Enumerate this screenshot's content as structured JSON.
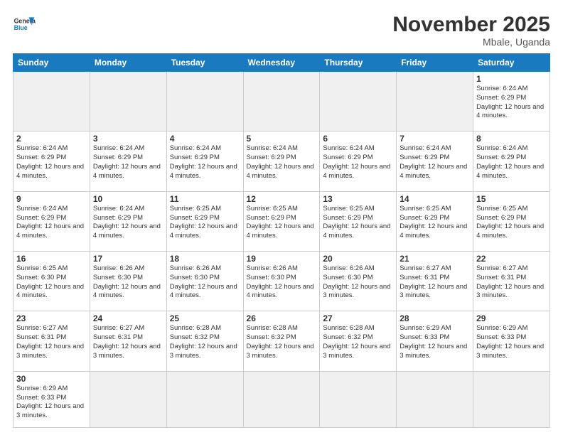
{
  "header": {
    "logo_general": "General",
    "logo_blue": "Blue",
    "month_title": "November 2025",
    "location": "Mbale, Uganda"
  },
  "days_of_week": [
    "Sunday",
    "Monday",
    "Tuesday",
    "Wednesday",
    "Thursday",
    "Friday",
    "Saturday"
  ],
  "weeks": [
    [
      {
        "day": "",
        "info": "",
        "empty": true
      },
      {
        "day": "",
        "info": "",
        "empty": true
      },
      {
        "day": "",
        "info": "",
        "empty": true
      },
      {
        "day": "",
        "info": "",
        "empty": true
      },
      {
        "day": "",
        "info": "",
        "empty": true
      },
      {
        "day": "",
        "info": "",
        "empty": true
      },
      {
        "day": "1",
        "info": "Sunrise: 6:24 AM\nSunset: 6:29 PM\nDaylight: 12 hours\nand 4 minutes."
      }
    ],
    [
      {
        "day": "2",
        "info": "Sunrise: 6:24 AM\nSunset: 6:29 PM\nDaylight: 12 hours\nand 4 minutes."
      },
      {
        "day": "3",
        "info": "Sunrise: 6:24 AM\nSunset: 6:29 PM\nDaylight: 12 hours\nand 4 minutes."
      },
      {
        "day": "4",
        "info": "Sunrise: 6:24 AM\nSunset: 6:29 PM\nDaylight: 12 hours\nand 4 minutes."
      },
      {
        "day": "5",
        "info": "Sunrise: 6:24 AM\nSunset: 6:29 PM\nDaylight: 12 hours\nand 4 minutes."
      },
      {
        "day": "6",
        "info": "Sunrise: 6:24 AM\nSunset: 6:29 PM\nDaylight: 12 hours\nand 4 minutes."
      },
      {
        "day": "7",
        "info": "Sunrise: 6:24 AM\nSunset: 6:29 PM\nDaylight: 12 hours\nand 4 minutes."
      },
      {
        "day": "8",
        "info": "Sunrise: 6:24 AM\nSunset: 6:29 PM\nDaylight: 12 hours\nand 4 minutes."
      }
    ],
    [
      {
        "day": "9",
        "info": "Sunrise: 6:24 AM\nSunset: 6:29 PM\nDaylight: 12 hours\nand 4 minutes."
      },
      {
        "day": "10",
        "info": "Sunrise: 6:24 AM\nSunset: 6:29 PM\nDaylight: 12 hours\nand 4 minutes."
      },
      {
        "day": "11",
        "info": "Sunrise: 6:25 AM\nSunset: 6:29 PM\nDaylight: 12 hours\nand 4 minutes."
      },
      {
        "day": "12",
        "info": "Sunrise: 6:25 AM\nSunset: 6:29 PM\nDaylight: 12 hours\nand 4 minutes."
      },
      {
        "day": "13",
        "info": "Sunrise: 6:25 AM\nSunset: 6:29 PM\nDaylight: 12 hours\nand 4 minutes."
      },
      {
        "day": "14",
        "info": "Sunrise: 6:25 AM\nSunset: 6:29 PM\nDaylight: 12 hours\nand 4 minutes."
      },
      {
        "day": "15",
        "info": "Sunrise: 6:25 AM\nSunset: 6:29 PM\nDaylight: 12 hours\nand 4 minutes."
      }
    ],
    [
      {
        "day": "16",
        "info": "Sunrise: 6:25 AM\nSunset: 6:30 PM\nDaylight: 12 hours\nand 4 minutes."
      },
      {
        "day": "17",
        "info": "Sunrise: 6:26 AM\nSunset: 6:30 PM\nDaylight: 12 hours\nand 4 minutes."
      },
      {
        "day": "18",
        "info": "Sunrise: 6:26 AM\nSunset: 6:30 PM\nDaylight: 12 hours\nand 4 minutes."
      },
      {
        "day": "19",
        "info": "Sunrise: 6:26 AM\nSunset: 6:30 PM\nDaylight: 12 hours\nand 4 minutes."
      },
      {
        "day": "20",
        "info": "Sunrise: 6:26 AM\nSunset: 6:30 PM\nDaylight: 12 hours\nand 3 minutes."
      },
      {
        "day": "21",
        "info": "Sunrise: 6:27 AM\nSunset: 6:31 PM\nDaylight: 12 hours\nand 3 minutes."
      },
      {
        "day": "22",
        "info": "Sunrise: 6:27 AM\nSunset: 6:31 PM\nDaylight: 12 hours\nand 3 minutes."
      }
    ],
    [
      {
        "day": "23",
        "info": "Sunrise: 6:27 AM\nSunset: 6:31 PM\nDaylight: 12 hours\nand 3 minutes."
      },
      {
        "day": "24",
        "info": "Sunrise: 6:27 AM\nSunset: 6:31 PM\nDaylight: 12 hours\nand 3 minutes."
      },
      {
        "day": "25",
        "info": "Sunrise: 6:28 AM\nSunset: 6:32 PM\nDaylight: 12 hours\nand 3 minutes."
      },
      {
        "day": "26",
        "info": "Sunrise: 6:28 AM\nSunset: 6:32 PM\nDaylight: 12 hours\nand 3 minutes."
      },
      {
        "day": "27",
        "info": "Sunrise: 6:28 AM\nSunset: 6:32 PM\nDaylight: 12 hours\nand 3 minutes."
      },
      {
        "day": "28",
        "info": "Sunrise: 6:29 AM\nSunset: 6:33 PM\nDaylight: 12 hours\nand 3 minutes."
      },
      {
        "day": "29",
        "info": "Sunrise: 6:29 AM\nSunset: 6:33 PM\nDaylight: 12 hours\nand 3 minutes."
      }
    ],
    [
      {
        "day": "30",
        "info": "Sunrise: 6:29 AM\nSunset: 6:33 PM\nDaylight: 12 hours\nand 3 minutes."
      },
      {
        "day": "",
        "info": "",
        "empty": true
      },
      {
        "day": "",
        "info": "",
        "empty": true
      },
      {
        "day": "",
        "info": "",
        "empty": true
      },
      {
        "day": "",
        "info": "",
        "empty": true
      },
      {
        "day": "",
        "info": "",
        "empty": true
      },
      {
        "day": "",
        "info": "",
        "empty": true
      }
    ]
  ]
}
